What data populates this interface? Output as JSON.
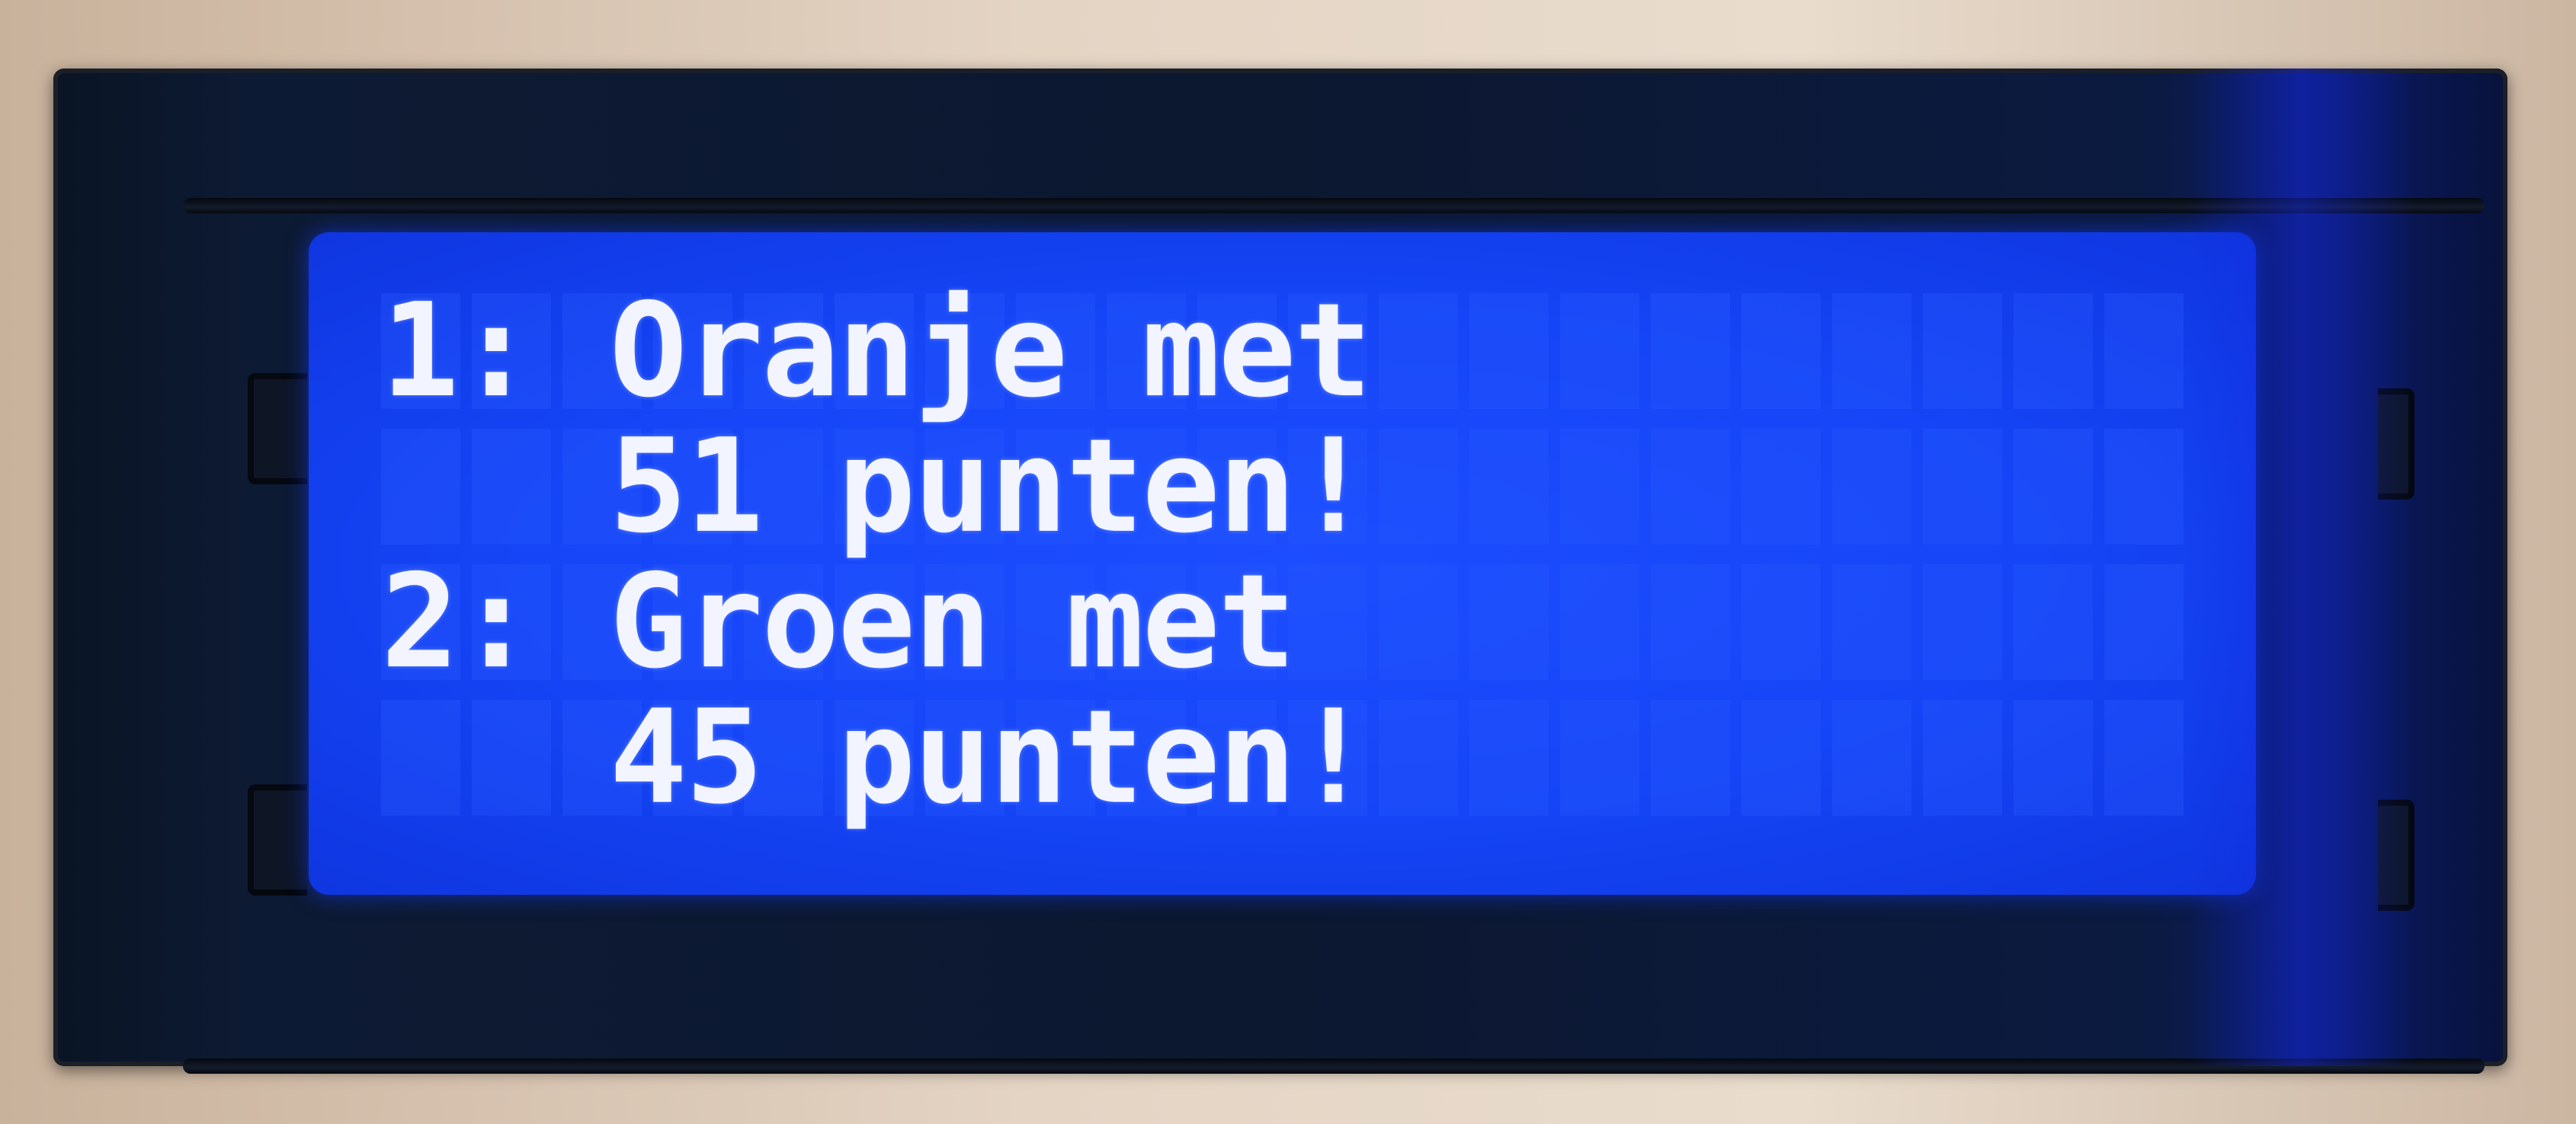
{
  "display": {
    "backlight_color": "#1545f6",
    "text_color": "#f2f4ff",
    "rows": 4,
    "columns": 20,
    "lines": [
      "1: Oranje met",
      "   51 punten!",
      "2: Groen met",
      "   45 punten!"
    ]
  }
}
